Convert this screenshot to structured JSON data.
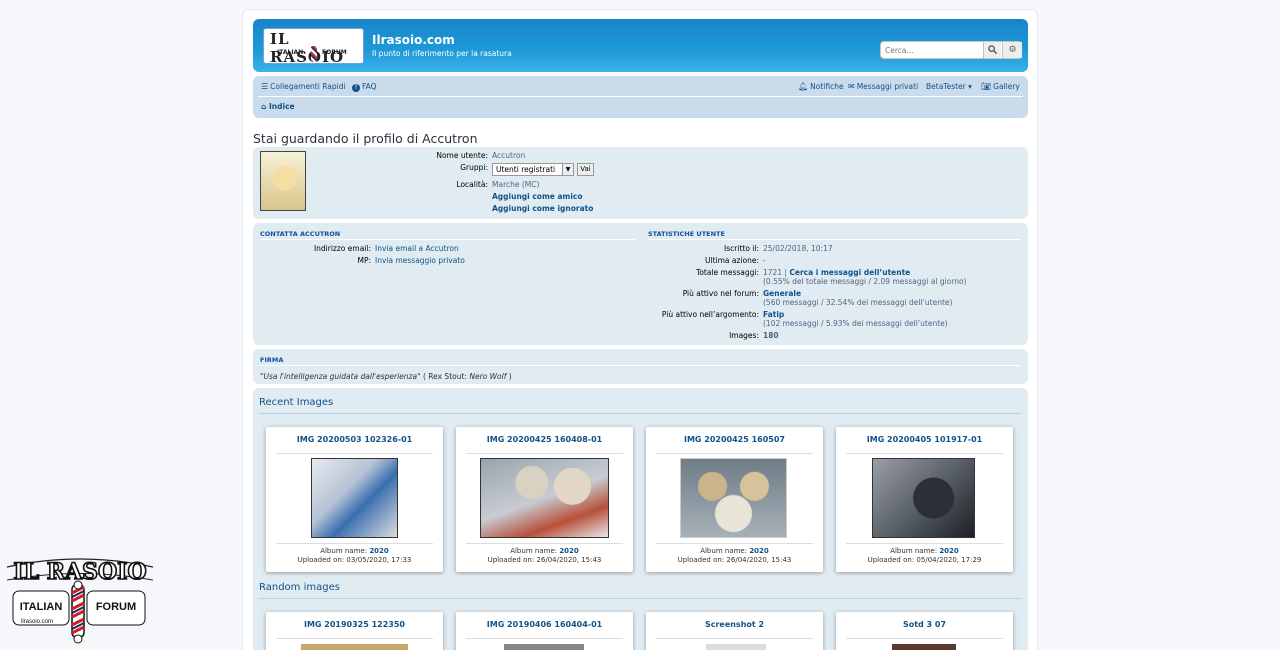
{
  "header": {
    "logo_top": "IL RASOIO",
    "logo_left": "ITALIAN",
    "logo_right": "FORUM",
    "site_title": "Ilrasoio.com",
    "site_desc": "Il punto di riferimento per la rasatura",
    "search_placeholder": "Cerca..."
  },
  "navbar": {
    "quick_links": "Collegamenti Rapidi",
    "faq": "FAQ",
    "notifications": "Notifiche",
    "private_messages": "Messaggi privati",
    "user": "BetaTester",
    "gallery": "Gallery",
    "breadcrumb": "Indice"
  },
  "page_title": "Stai guardando il profilo di Accutron",
  "profile": {
    "username_label": "Nome utente:",
    "username": "Accutron",
    "groups_label": "Gruppi:",
    "group_selected": "Utenti registrati",
    "go_button": "Vai",
    "location_label": "Località:",
    "location": "Marche (MC)",
    "add_friend": "Aggiungi come amico",
    "add_ignored": "Aggiungi come ignorato"
  },
  "contact": {
    "heading": "CONTATTA ACCUTRON",
    "email_label": "Indirizzo email:",
    "email_link": "Invia email a Accutron",
    "pm_label": "MP:",
    "pm_link": "Invia messaggio privato"
  },
  "stats": {
    "heading": "STATISTICHE UTENTE",
    "joined_label": "Iscritto il:",
    "joined": "25/02/2018, 10:17",
    "last_action_label": "Ultima azione:",
    "last_action": "-",
    "total_posts_label": "Totale messaggi:",
    "total_posts": "1721 |",
    "search_posts": "Cerca i messaggi dell’utente",
    "total_posts_sub": "(0.55% del totale messaggi / 2.09 messaggi al giorno)",
    "most_active_forum_label": "Più attivo nel forum:",
    "most_active_forum": "Generale",
    "most_active_forum_sub": "(560 messaggi / 32.54% dei messaggi dell’utente)",
    "most_active_topic_label": "Più attivo nell’argomento:",
    "most_active_topic": "Fatip",
    "most_active_topic_sub": "(102 messaggi / 5.93% dei messaggi dell’utente)",
    "images_label": "Images:",
    "images": "180"
  },
  "signature": {
    "heading": "FIRMA",
    "quote": "\"Usa l'intelligenza guidata dall'esperienza\"",
    "author_prefix": "( Rex Stout:",
    "author_work": "Nero Wolf",
    "author_suffix": ")"
  },
  "recent_images": {
    "title": "Recent Images",
    "album_label": "Album name:",
    "uploaded_label": "Uploaded on:",
    "items": [
      {
        "title": "IMG 20200503 102326-01",
        "album": "2020",
        "uploaded": "03/05/2020, 17:33"
      },
      {
        "title": "IMG 20200425 160408-01",
        "album": "2020",
        "uploaded": "26/04/2020, 15:43"
      },
      {
        "title": "IMG 20200425 160507",
        "album": "2020",
        "uploaded": "26/04/2020, 15:43"
      },
      {
        "title": "IMG 20200405 101917-01",
        "album": "2020",
        "uploaded": "05/04/2020, 17:29"
      }
    ]
  },
  "random_images": {
    "title": "Random images",
    "items": [
      {
        "title": "IMG 20190325 122350"
      },
      {
        "title": "IMG 20190406 160404-01"
      },
      {
        "title": "Screenshot 2"
      },
      {
        "title": "Sotd 3 07"
      }
    ]
  },
  "watermark": {
    "line1": "IL RASOIO",
    "line2": "ITALIAN",
    "line3": "FORUM",
    "site": "ilrasoio.com"
  }
}
